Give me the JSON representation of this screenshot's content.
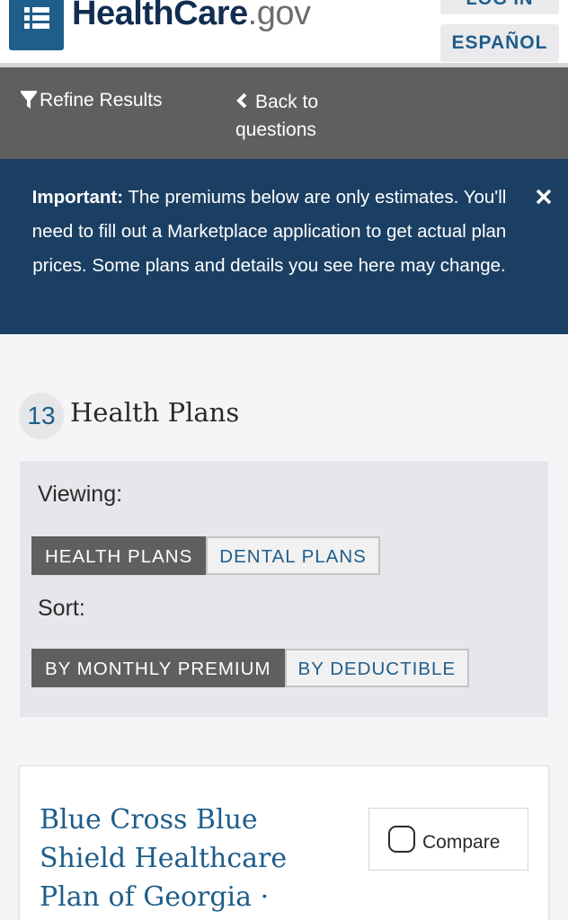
{
  "header": {
    "logo_primary": "HealthCare",
    "logo_suffix": ".gov",
    "menu_icon": "menu-list-icon",
    "login_label": "LOG IN",
    "spanish_label": "ESPAÑOL"
  },
  "toolbar": {
    "refine_label": "Refine Results",
    "back_label": "Back to questions"
  },
  "notice": {
    "bold_label": "Important:",
    "message": " The premiums below are only estimates. You'll need to fill out a Marketplace application to get actual plan prices. Some plans and details you see here may change."
  },
  "results": {
    "count": "13",
    "title": "Health Plans"
  },
  "filters": {
    "viewing_label": "Viewing:",
    "viewing_options": [
      "HEALTH PLANS",
      "DENTAL PLANS"
    ],
    "viewing_selected": "HEALTH PLANS",
    "sort_label": "Sort:",
    "sort_options": [
      "BY MONTHLY PREMIUM",
      "BY DEDUCTIBLE"
    ],
    "sort_selected": "BY MONTHLY PREMIUM"
  },
  "plan": {
    "name": "Blue Cross Blue Shield Healthcare Plan of Georgia ·",
    "compare_label": "Compare",
    "compare_checked": false
  },
  "colors": {
    "brand_blue": "#1f5d8a",
    "notice_bg": "#1b3f63",
    "toolbar_bg": "#5f5f60"
  }
}
